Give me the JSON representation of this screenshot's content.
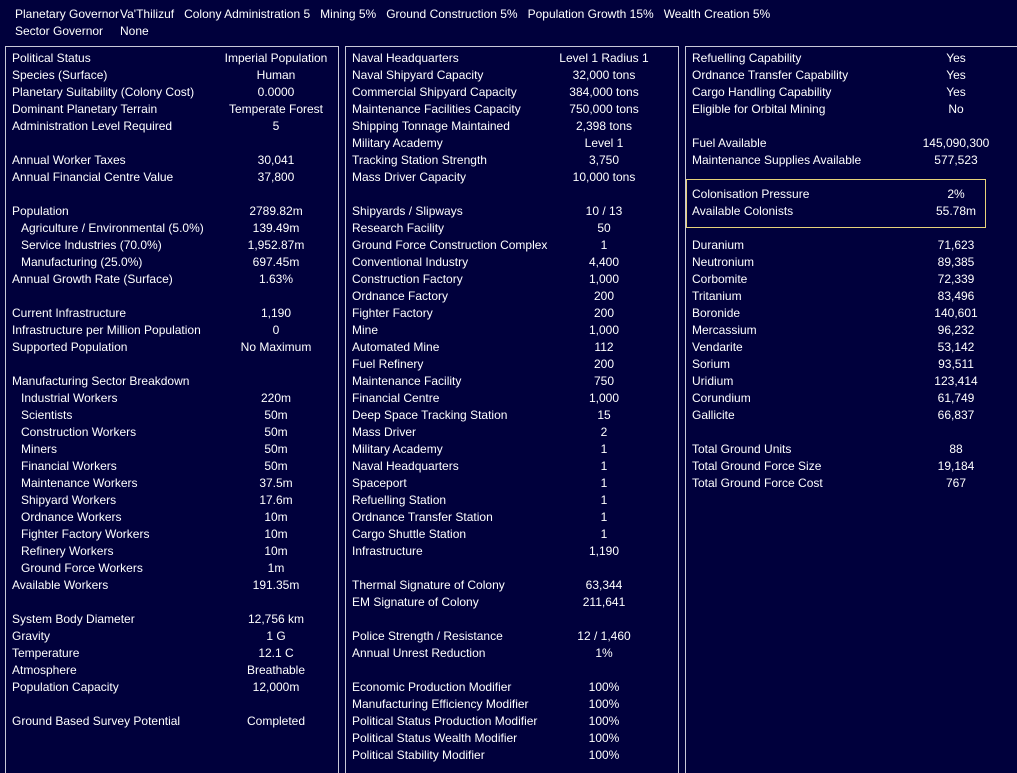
{
  "header": {
    "row1": [
      "Planetary Governor",
      "Va'Thilizuf",
      "Colony Administration 5",
      "Mining 5%",
      "Ground Construction 5%",
      "Population Growth 15%",
      "Wealth Creation 5%"
    ],
    "row2": [
      "Sector Governor",
      "None"
    ]
  },
  "panels": [
    {
      "name": "population-panel",
      "rows": [
        {
          "l": "Political Status",
          "v": "Imperial Population"
        },
        {
          "l": "Species (Surface)",
          "v": "Human"
        },
        {
          "l": "Planetary Suitability (Colony Cost)",
          "v": "0.0000"
        },
        {
          "l": "Dominant Planetary Terrain",
          "v": "Temperate Forest"
        },
        {
          "l": "Administration Level Required",
          "v": "5"
        },
        {
          "l": "",
          "v": ""
        },
        {
          "l": "Annual Worker Taxes",
          "v": "30,041"
        },
        {
          "l": "Annual Financial Centre Value",
          "v": "37,800"
        },
        {
          "l": "",
          "v": ""
        },
        {
          "l": "Population",
          "v": "2789.82m"
        },
        {
          "l": "Agriculture / Environmental (5.0%)",
          "v": "139.49m",
          "i": true
        },
        {
          "l": "Service Industries (70.0%)",
          "v": "1,952.87m",
          "i": true
        },
        {
          "l": "Manufacturing (25.0%)",
          "v": "697.45m",
          "i": true
        },
        {
          "l": "Annual Growth Rate (Surface)",
          "v": "1.63%"
        },
        {
          "l": "",
          "v": ""
        },
        {
          "l": "Current Infrastructure",
          "v": "1,190"
        },
        {
          "l": "Infrastructure per Million Population",
          "v": "0"
        },
        {
          "l": "Supported Population",
          "v": "No Maximum"
        },
        {
          "l": "",
          "v": ""
        },
        {
          "l": "Manufacturing Sector Breakdown",
          "v": ""
        },
        {
          "l": "Industrial Workers",
          "v": "220m",
          "i": true
        },
        {
          "l": "Scientists",
          "v": "50m",
          "i": true
        },
        {
          "l": "Construction Workers",
          "v": "50m",
          "i": true
        },
        {
          "l": "Miners",
          "v": "50m",
          "i": true
        },
        {
          "l": "Financial Workers",
          "v": "50m",
          "i": true
        },
        {
          "l": "Maintenance Workers",
          "v": "37.5m",
          "i": true
        },
        {
          "l": "Shipyard Workers",
          "v": "17.6m",
          "i": true
        },
        {
          "l": "Ordnance Workers",
          "v": "10m",
          "i": true
        },
        {
          "l": "Fighter Factory Workers",
          "v": "10m",
          "i": true
        },
        {
          "l": "Refinery Workers",
          "v": "10m",
          "i": true
        },
        {
          "l": "Ground Force Workers",
          "v": "1m",
          "i": true
        },
        {
          "l": "Available Workers",
          "v": "191.35m"
        },
        {
          "l": "",
          "v": ""
        },
        {
          "l": "System Body Diameter",
          "v": "12,756 km"
        },
        {
          "l": "Gravity",
          "v": "1 G"
        },
        {
          "l": "Temperature",
          "v": "12.1 C"
        },
        {
          "l": "Atmosphere",
          "v": "Breathable"
        },
        {
          "l": "Population Capacity",
          "v": "12,000m"
        },
        {
          "l": "",
          "v": ""
        },
        {
          "l": "Ground Based Survey Potential",
          "v": "Completed"
        }
      ]
    },
    {
      "name": "installations-panel",
      "rows": [
        {
          "l": "Naval Headquarters",
          "v": "Level 1  Radius 1"
        },
        {
          "l": "Naval Shipyard Capacity",
          "v": "32,000 tons"
        },
        {
          "l": "Commercial Shipyard Capacity",
          "v": "384,000 tons"
        },
        {
          "l": "Maintenance Facilities Capacity",
          "v": "750,000 tons"
        },
        {
          "l": "Shipping Tonnage Maintained",
          "v": "2,398 tons"
        },
        {
          "l": "Military Academy",
          "v": "Level 1"
        },
        {
          "l": "Tracking Station Strength",
          "v": "3,750"
        },
        {
          "l": "Mass Driver Capacity",
          "v": "10,000 tons"
        },
        {
          "l": "",
          "v": ""
        },
        {
          "l": "Shipyards / Slipways",
          "v": "10 / 13"
        },
        {
          "l": "Research Facility",
          "v": "50"
        },
        {
          "l": "Ground Force Construction Complex",
          "v": "1"
        },
        {
          "l": "Conventional Industry",
          "v": "4,400"
        },
        {
          "l": "Construction Factory",
          "v": "1,000"
        },
        {
          "l": "Ordnance Factory",
          "v": "200"
        },
        {
          "l": "Fighter Factory",
          "v": "200"
        },
        {
          "l": "Mine",
          "v": "1,000"
        },
        {
          "l": "Automated Mine",
          "v": "112"
        },
        {
          "l": "Fuel Refinery",
          "v": "200"
        },
        {
          "l": "Maintenance Facility",
          "v": "750"
        },
        {
          "l": "Financial Centre",
          "v": "1,000"
        },
        {
          "l": "Deep Space Tracking Station",
          "v": "15"
        },
        {
          "l": "Mass Driver",
          "v": "2"
        },
        {
          "l": "Military Academy",
          "v": "1"
        },
        {
          "l": "Naval Headquarters",
          "v": "1"
        },
        {
          "l": "Spaceport",
          "v": "1"
        },
        {
          "l": "Refuelling Station",
          "v": "1"
        },
        {
          "l": "Ordnance Transfer Station",
          "v": "1"
        },
        {
          "l": "Cargo Shuttle Station",
          "v": "1"
        },
        {
          "l": "Infrastructure",
          "v": "1,190"
        },
        {
          "l": "",
          "v": ""
        },
        {
          "l": "Thermal Signature of Colony",
          "v": "63,344"
        },
        {
          "l": "EM Signature of Colony",
          "v": "211,641"
        },
        {
          "l": "",
          "v": ""
        },
        {
          "l": "Police Strength / Resistance",
          "v": "12 / 1,460"
        },
        {
          "l": "Annual Unrest Reduction",
          "v": "1%"
        },
        {
          "l": "",
          "v": ""
        },
        {
          "l": "Economic Production Modifier",
          "v": "100%"
        },
        {
          "l": "Manufacturing Efficiency Modifier",
          "v": "100%"
        },
        {
          "l": "Political Status Production Modifier",
          "v": "100%"
        },
        {
          "l": "Political Status Wealth Modifier",
          "v": "100%"
        },
        {
          "l": "Political Stability Modifier",
          "v": "100%"
        }
      ]
    },
    {
      "name": "resources-panel",
      "rows": [
        {
          "l": "Refuelling Capability",
          "v": "Yes"
        },
        {
          "l": "Ordnance Transfer Capability",
          "v": "Yes"
        },
        {
          "l": "Cargo Handling Capability",
          "v": "Yes"
        },
        {
          "l": "Eligible for Orbital Mining",
          "v": "No"
        },
        {
          "l": "",
          "v": ""
        },
        {
          "l": "Fuel Available",
          "v": "145,090,300"
        },
        {
          "l": "Maintenance Supplies Available",
          "v": "577,523"
        },
        {
          "l": "",
          "v": ""
        },
        {
          "l": "Colonisation Pressure",
          "v": "2%"
        },
        {
          "l": "Available Colonists",
          "v": "55.78m"
        },
        {
          "l": "",
          "v": ""
        },
        {
          "l": "Duranium",
          "v": "71,623"
        },
        {
          "l": "Neutronium",
          "v": "89,385"
        },
        {
          "l": "Corbomite",
          "v": "72,339"
        },
        {
          "l": "Tritanium",
          "v": "83,496"
        },
        {
          "l": "Boronide",
          "v": "140,601"
        },
        {
          "l": "Mercassium",
          "v": "96,232"
        },
        {
          "l": "Vendarite",
          "v": "53,142"
        },
        {
          "l": "Sorium",
          "v": "93,511"
        },
        {
          "l": "Uridium",
          "v": "123,414"
        },
        {
          "l": "Corundium",
          "v": "61,749"
        },
        {
          "l": "Gallicite",
          "v": "66,837"
        },
        {
          "l": "",
          "v": ""
        },
        {
          "l": "Total Ground Units",
          "v": "88"
        },
        {
          "l": "Total Ground Force Size",
          "v": "19,184"
        },
        {
          "l": "Total Ground Force Cost",
          "v": "767"
        }
      ]
    }
  ]
}
